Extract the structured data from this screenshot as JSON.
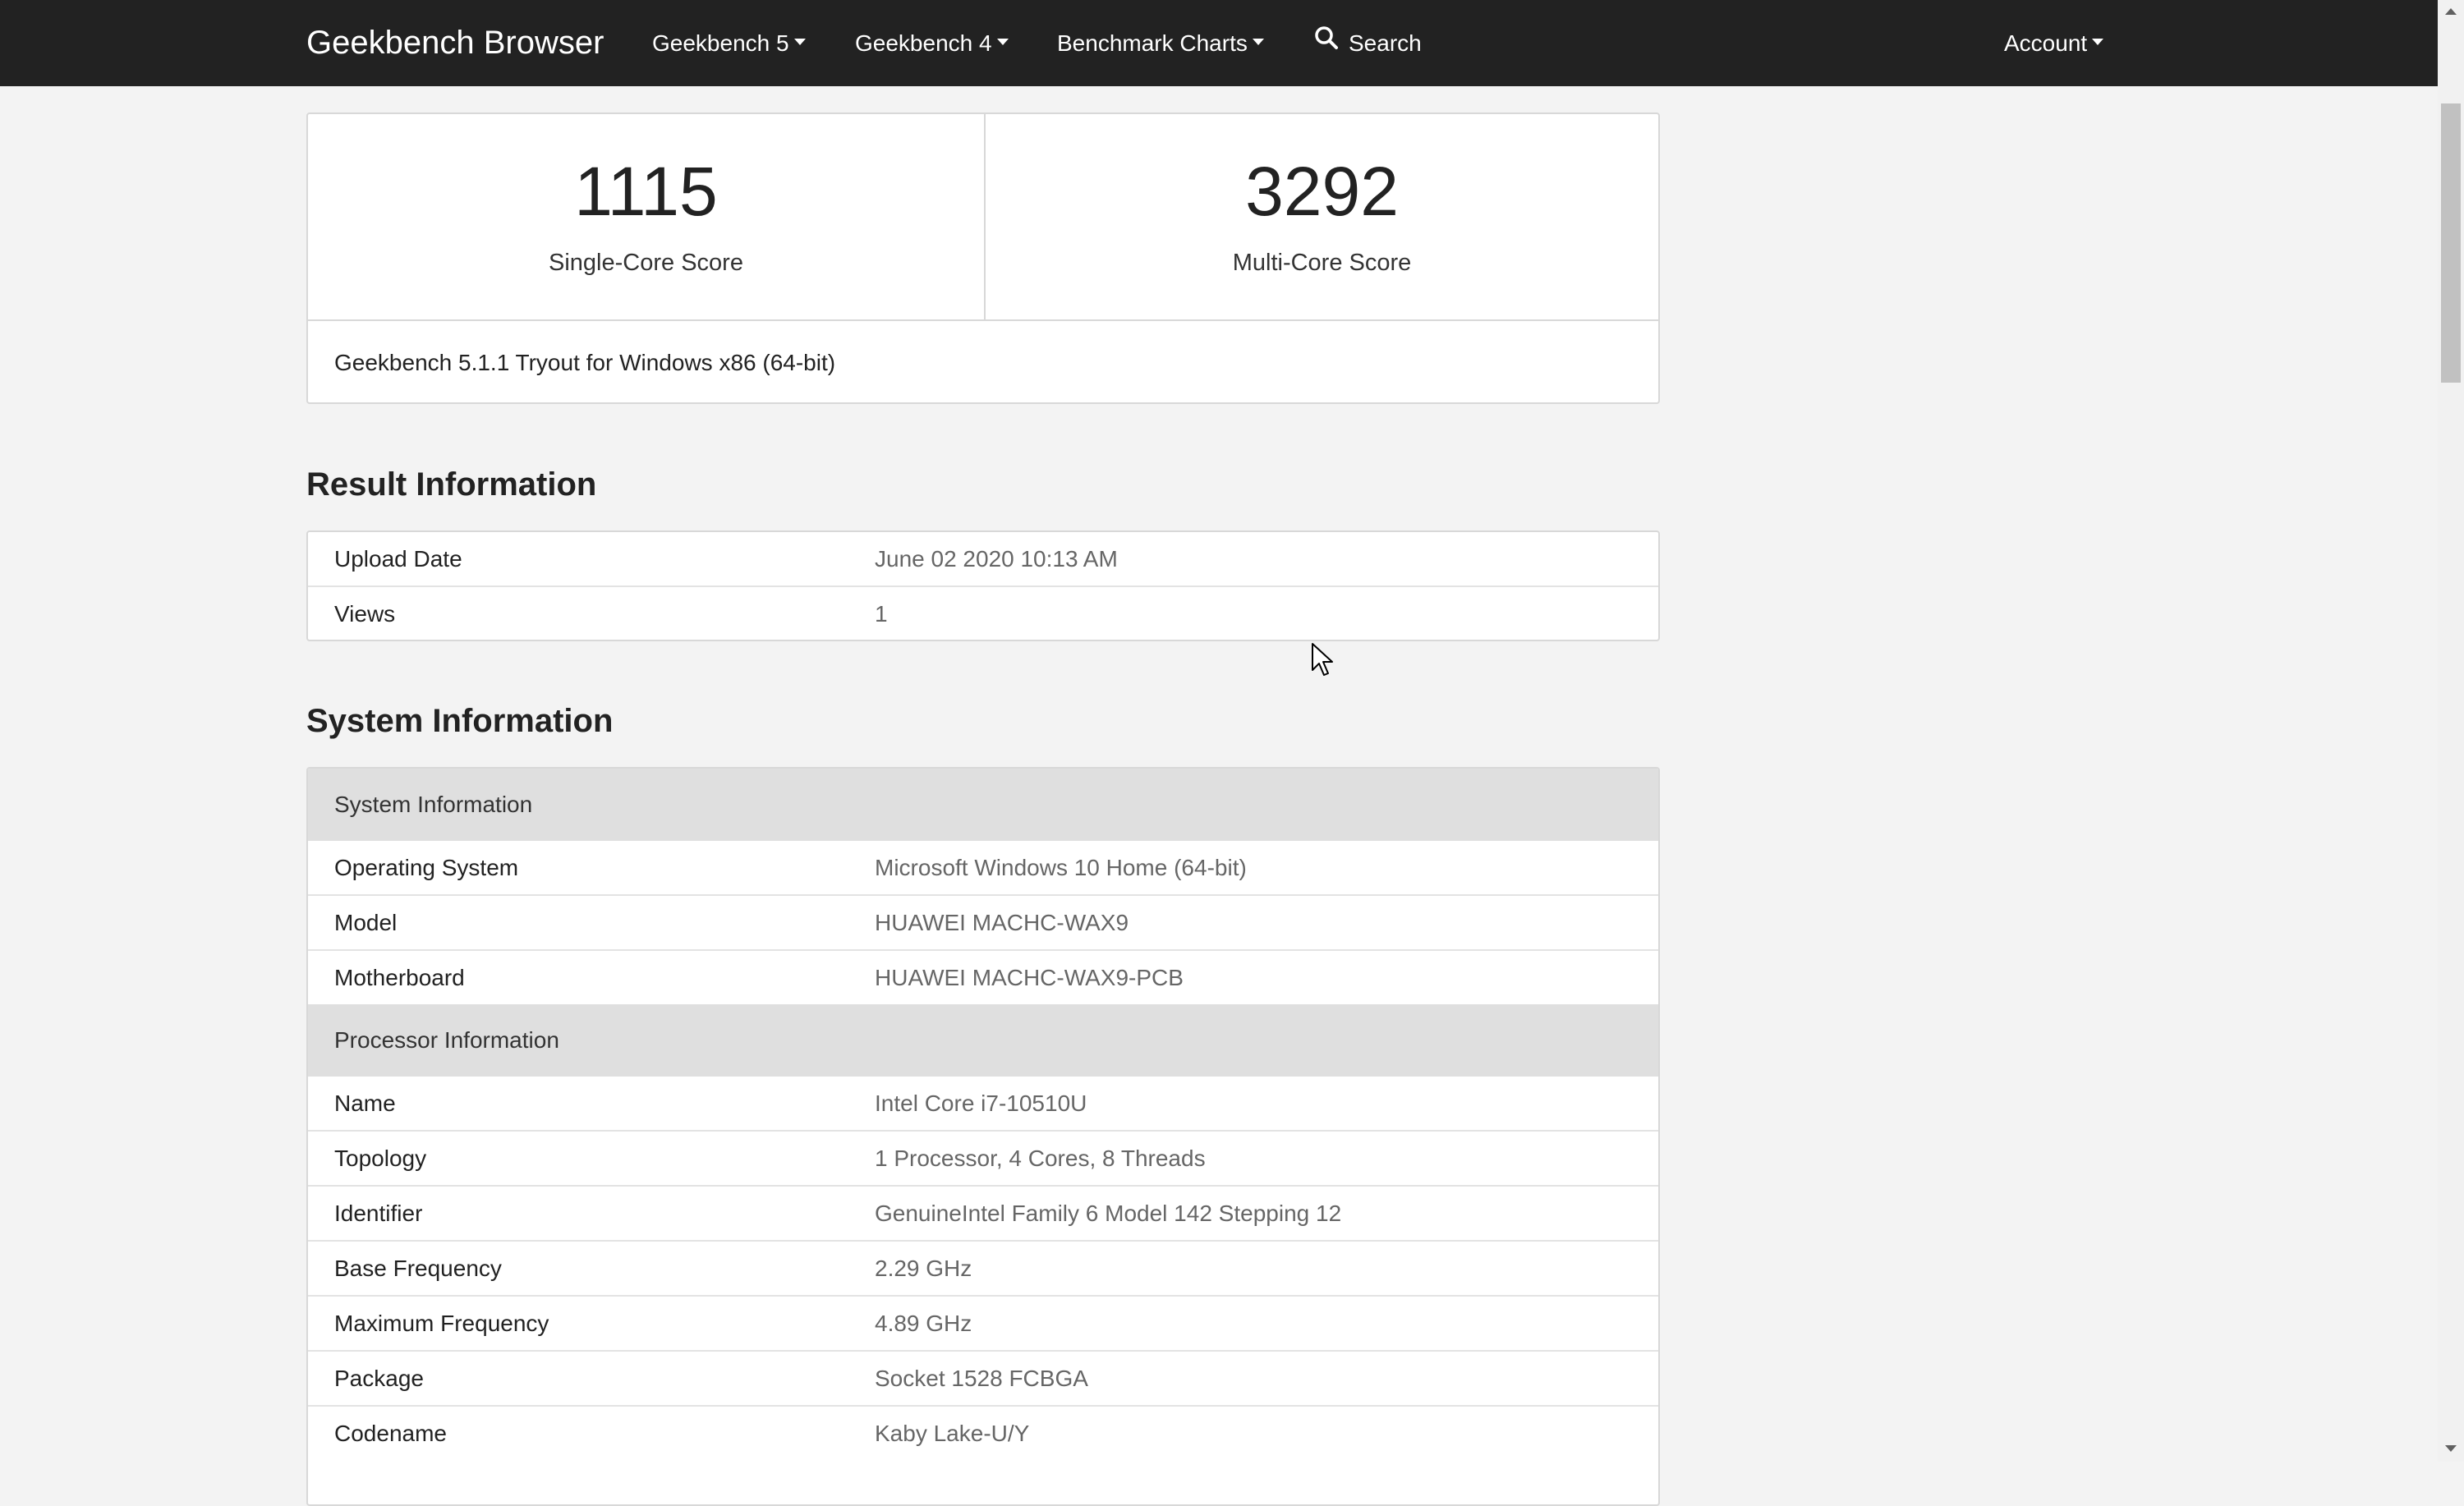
{
  "navbar": {
    "brand": "Geekbench Browser",
    "items": [
      {
        "label": "Geekbench 5"
      },
      {
        "label": "Geekbench 4"
      },
      {
        "label": "Benchmark Charts"
      }
    ],
    "search_label": "Search",
    "account_label": "Account",
    "background": "#222222"
  },
  "scores": {
    "single_core": {
      "value": "1115",
      "label": "Single-Core Score"
    },
    "multi_core": {
      "value": "3292",
      "label": "Multi-Core Score"
    },
    "version": "Geekbench 5.1.1 Tryout for Windows x86 (64-bit)"
  },
  "result_info": {
    "title": "Result Information",
    "rows": [
      {
        "key": "Upload Date",
        "value": "June 02 2020 10:13 AM"
      },
      {
        "key": "Views",
        "value": "1"
      }
    ]
  },
  "system_info": {
    "title": "System Information",
    "groups": [
      {
        "header": "System Information",
        "rows": [
          {
            "key": "Operating System",
            "value": "Microsoft Windows 10 Home (64-bit)"
          },
          {
            "key": "Model",
            "value": "HUAWEI MACHC-WAX9"
          },
          {
            "key": "Motherboard",
            "value": "HUAWEI MACHC-WAX9-PCB"
          }
        ]
      },
      {
        "header": "Processor Information",
        "rows": [
          {
            "key": "Name",
            "value": "Intel Core i7-10510U"
          },
          {
            "key": "Topology",
            "value": "1 Processor, 4 Cores, 8 Threads"
          },
          {
            "key": "Identifier",
            "value": "GenuineIntel Family 6 Model 142 Stepping 12"
          },
          {
            "key": "Base Frequency",
            "value": "2.29 GHz"
          },
          {
            "key": "Maximum Frequency",
            "value": "4.89 GHz"
          },
          {
            "key": "Package",
            "value": "Socket 1528 FCBGA"
          },
          {
            "key": "Codename",
            "value": "Kaby Lake-U/Y"
          }
        ]
      }
    ]
  }
}
